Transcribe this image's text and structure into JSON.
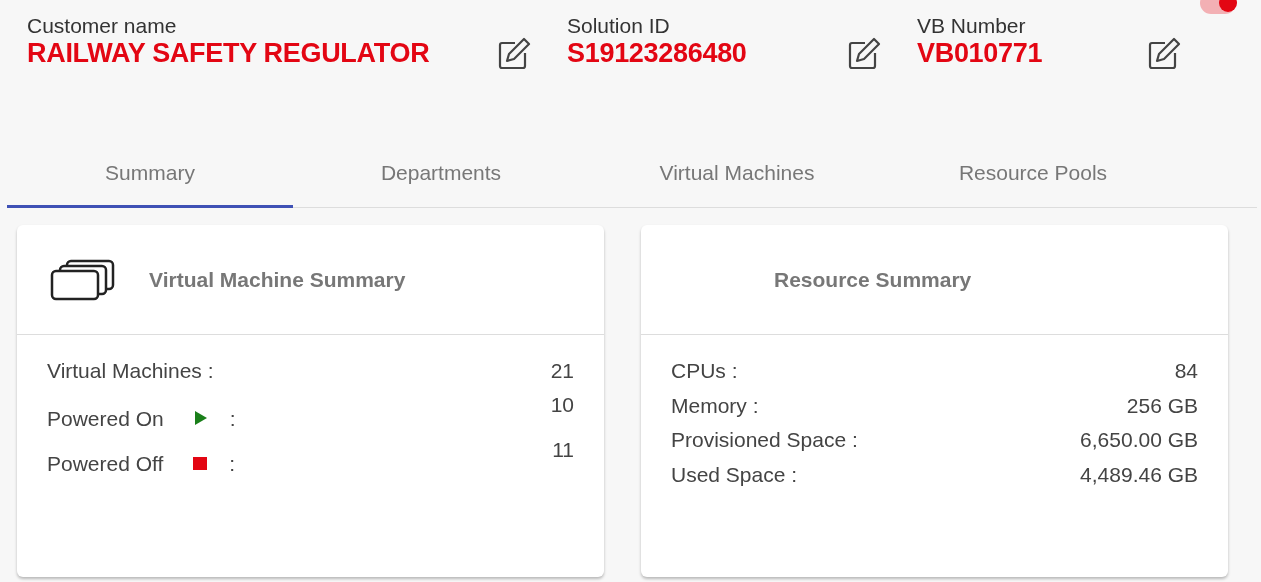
{
  "toggle": {
    "on": true
  },
  "header_fields": [
    {
      "label": "Customer name",
      "value": "RAILWAY SAFETY REGULATOR"
    },
    {
      "label": "Solution ID",
      "value": "S19123286480"
    },
    {
      "label": "VB Number",
      "value": "VB010771"
    }
  ],
  "tabs": [
    {
      "label": "Summary",
      "selected": true
    },
    {
      "label": "Departments",
      "selected": false
    },
    {
      "label": "Virtual Machines",
      "selected": false
    },
    {
      "label": "Resource Pools",
      "selected": false
    }
  ],
  "vm_summary": {
    "title": "Virtual Machine Summary",
    "rows": [
      {
        "kind": "plain",
        "label": "Virtual Machines :",
        "value": "21"
      },
      {
        "kind": "on",
        "label": "Powered On",
        "separator": ":",
        "value": "10"
      },
      {
        "kind": "off",
        "label": "Powered Off",
        "separator": ":",
        "value": "11"
      }
    ]
  },
  "resource_summary": {
    "title": "Resource Summary",
    "rows": [
      {
        "label": "CPUs :",
        "value": "84"
      },
      {
        "label": "Memory :",
        "value": "256 GB"
      },
      {
        "label": "Provisioned Space :",
        "value": "6,650.00 GB"
      },
      {
        "label": "Used Space :",
        "value": "4,489.46 GB"
      }
    ]
  }
}
